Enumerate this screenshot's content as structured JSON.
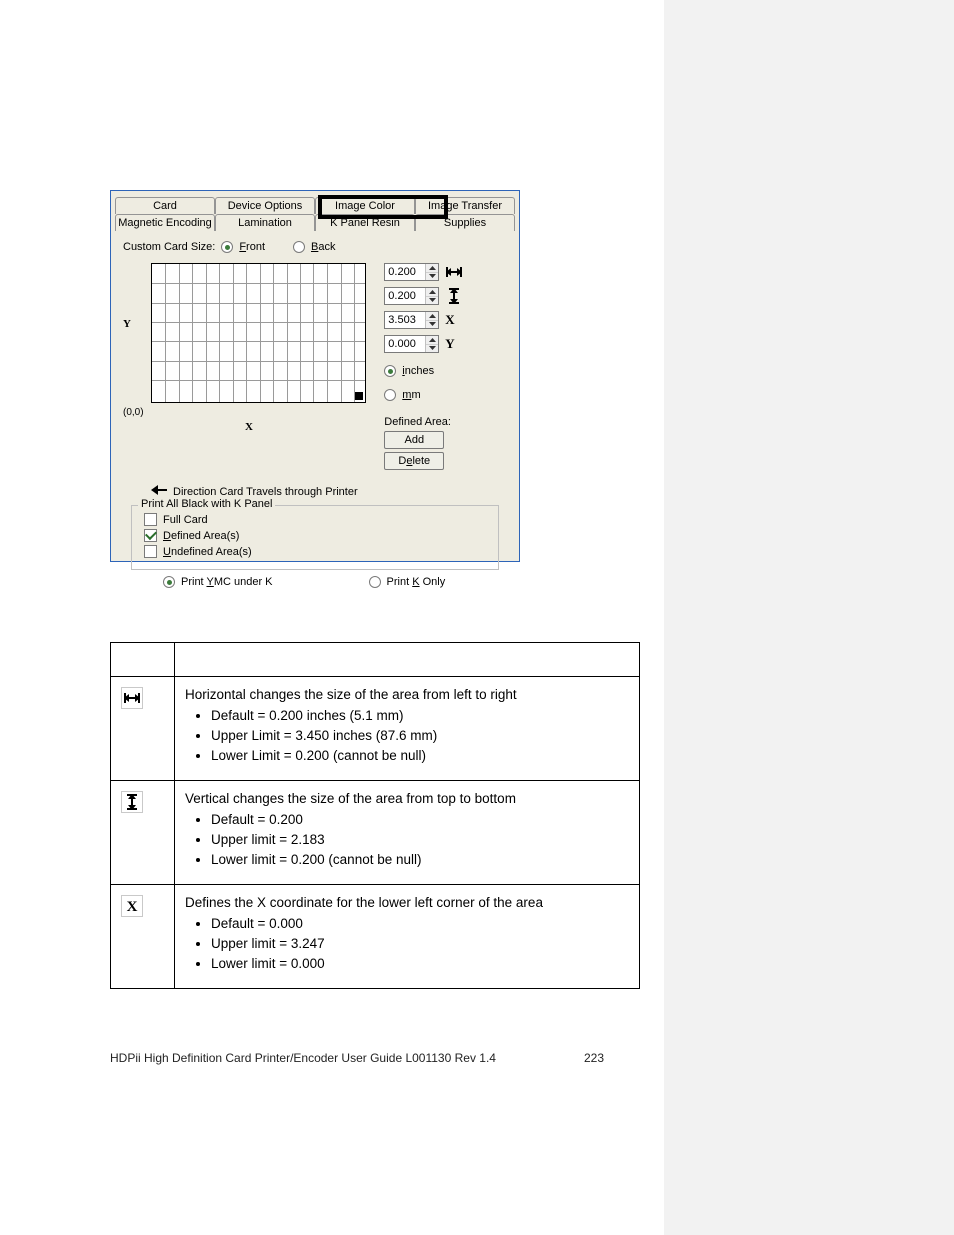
{
  "dialog": {
    "tabs_row1": [
      "Card",
      "Device Options",
      "Image Color",
      "Image Transfer"
    ],
    "tabs_row2": [
      "Magnetic Encoding",
      "Lamination",
      "K Panel Resin",
      "Supplies"
    ],
    "custom_card_size_label": "Custom Card Size:",
    "front_label": "Front",
    "back_label": "Back",
    "front_selected": true,
    "y_axis": "Y",
    "x_axis": "X",
    "origin": "(0,0)",
    "spinners": {
      "width": "0.200",
      "height": "0.200",
      "x": "3.503",
      "y": "0.000",
      "x_letter": "X",
      "y_letter": "Y"
    },
    "units": {
      "inches": "inches",
      "mm": "mm",
      "inches_selected": true
    },
    "defined_area_label": "Defined Area:",
    "add_label": "Add",
    "delete_label": "Delete",
    "direction_label": "Direction Card Travels through Printer",
    "fieldset_legend": "Print All Black with K Panel",
    "full_card_label": "Full Card",
    "defined_areas_label": "Defined Area(s)",
    "undefined_areas_label": "Undefined Area(s)",
    "defined_checked": true,
    "print_ymc_label": "Print YMC under K",
    "print_k_only_label": "Print K Only",
    "print_ymc_selected": true
  },
  "table": {
    "rows": [
      {
        "icon": "width",
        "lead": "Horizontal changes the size of the area from left to right",
        "bullets": [
          "Default = 0.200 inches (5.1 mm)",
          "Upper Limit = 3.450 inches (87.6 mm)",
          "Lower Limit = 0.200 (cannot be null)"
        ]
      },
      {
        "icon": "height",
        "lead": "Vertical changes the size of the area from top to bottom",
        "bullets": [
          "Default = 0.200",
          "Upper limit = 2.183",
          "Lower limit = 0.200 (cannot be null)"
        ]
      },
      {
        "icon": "x",
        "lead": "Defines the X coordinate for the lower left corner of the area",
        "bullets": [
          "Default = 0.000",
          "Upper limit = 3.247",
          "Lower limit = 0.000"
        ]
      }
    ]
  },
  "footer": {
    "left": "HDPii High Definition Card Printer/Encoder User Guide    L001130 Rev 1.4",
    "page": "223"
  }
}
